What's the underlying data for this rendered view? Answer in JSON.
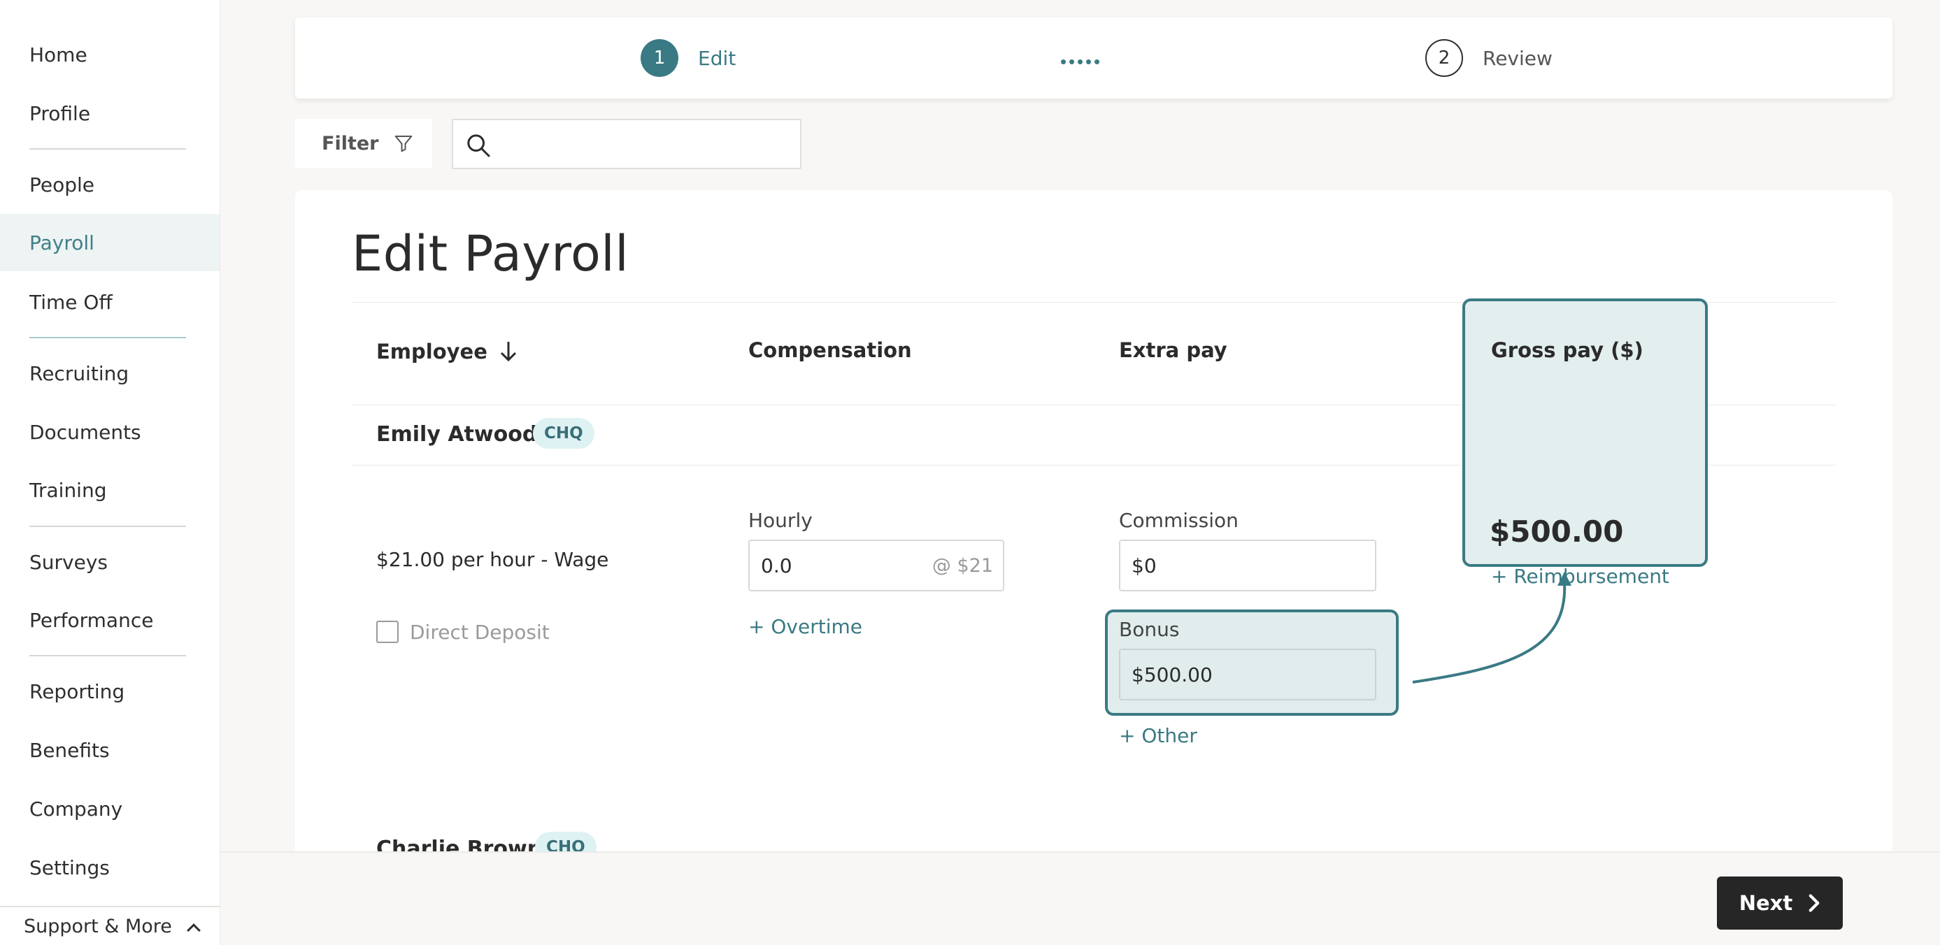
{
  "sidebar": {
    "items": [
      {
        "label": "Home"
      },
      {
        "label": "Profile"
      },
      {
        "label": "People"
      },
      {
        "label": "Payroll",
        "active": true
      },
      {
        "label": "Time Off"
      },
      {
        "label": "Recruiting"
      },
      {
        "label": "Documents"
      },
      {
        "label": "Training"
      },
      {
        "label": "Surveys"
      },
      {
        "label": "Performance"
      },
      {
        "label": "Reporting"
      },
      {
        "label": "Benefits"
      },
      {
        "label": "Company"
      },
      {
        "label": "Settings"
      }
    ],
    "support_label": "Support & More"
  },
  "stepper": {
    "steps": [
      {
        "number": "1",
        "label": "Edit",
        "state": "current"
      },
      {
        "number": "2",
        "label": "Review",
        "state": "upcoming"
      }
    ]
  },
  "toolbar": {
    "filter_label": "Filter",
    "search_value": "",
    "search_placeholder": ""
  },
  "page": {
    "title": "Edit Payroll"
  },
  "table": {
    "headers": {
      "employee": "Employee",
      "compensation": "Compensation",
      "extra_pay": "Extra pay",
      "gross_pay": "Gross pay ($)"
    },
    "employees": [
      {
        "name": "Emily Atwood",
        "tag": "CHQ",
        "wage": "$21.00 per hour - Wage",
        "direct_deposit_label": "Direct Deposit",
        "direct_deposit_checked": false,
        "hourly_label": "Hourly",
        "hourly_value": "0.0",
        "hourly_rate_suffix": "@ $21",
        "overtime_link": "+ Overtime",
        "commission_label": "Commission",
        "commission_value": "$0",
        "bonus_label": "Bonus",
        "bonus_value": "$500.00",
        "other_link": "+ Other",
        "gross_pay": "$500.00",
        "reimbursement_link": "+ Reimbursement"
      },
      {
        "name": "Charlie Brown",
        "tag": "CHQ"
      }
    ]
  },
  "footer": {
    "next_label": "Next"
  },
  "colors": {
    "accent": "#3a7a84",
    "highlight_fill": "#e1eded",
    "tag_fill": "#def2f3",
    "next_button": "#262626",
    "active_nav_bg": "#eef3f4"
  }
}
